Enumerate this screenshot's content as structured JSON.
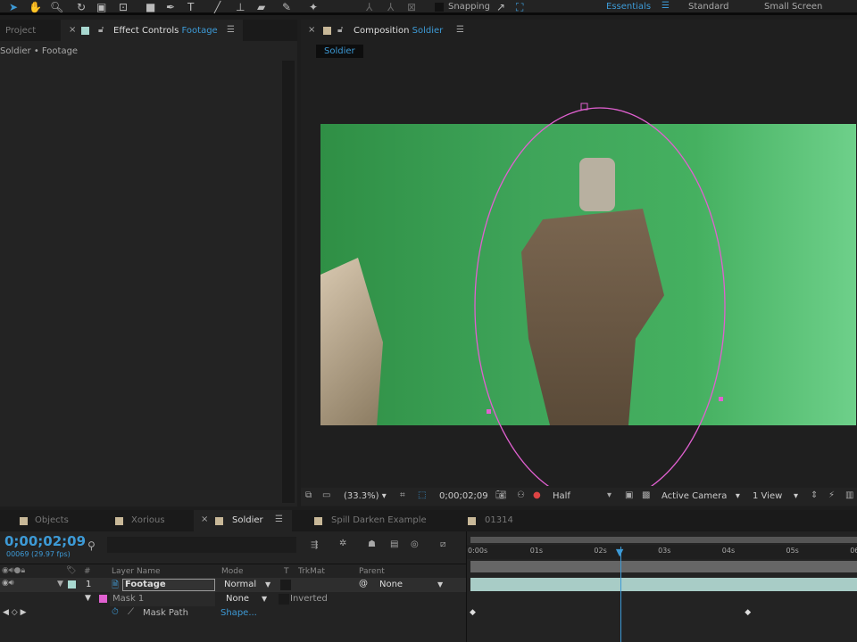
{
  "toolbar": {
    "snapping": "Snapping",
    "workspaces": [
      "Essentials",
      "Standard",
      "Small Screen"
    ]
  },
  "left_panel": {
    "tab_project": "Project",
    "tab_effect_controls": "Effect Controls",
    "effect_target": "Footage",
    "breadcrumb": "Soldier • Footage"
  },
  "comp_panel": {
    "tab_label": "Composition",
    "comp_name": "Soldier",
    "sub_tab": "Soldier",
    "footer": {
      "zoom": "(33.3%)",
      "timecode": "0;00;02;09",
      "resolution": "Half",
      "camera": "Active Camera",
      "views": "1 View"
    }
  },
  "timeline_tabs": [
    "Objects",
    "Xorious",
    "Soldier",
    "Spill Darken Example",
    "01314"
  ],
  "timeline": {
    "timecode": "0;00;02;09",
    "frame_info": "00069 (29.97 fps)",
    "columns": {
      "num": "#",
      "layer_name": "Layer Name",
      "mode": "Mode",
      "t": "T",
      "trkmat": "TrkMat",
      "parent": "Parent"
    },
    "layer": {
      "num": "1",
      "name": "Footage",
      "mode": "Normal",
      "parent": "None"
    },
    "mask": {
      "name": "Mask 1",
      "mode": "None",
      "inverted": "Inverted"
    },
    "property": {
      "name": "Mask Path",
      "value": "Shape..."
    },
    "ruler": [
      "0:00s",
      "01s",
      "02s",
      "03s",
      "04s",
      "05s",
      "06"
    ],
    "playhead_seconds": 2.3,
    "keyframes_seconds": [
      0,
      4.3
    ]
  },
  "colors": {
    "accent": "#3d9ad6",
    "mask": "#e060d0",
    "layer_label": "#a8d8d0",
    "screen_green": "#3fa55a"
  }
}
